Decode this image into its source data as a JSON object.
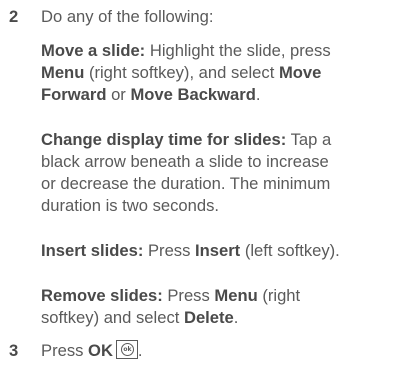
{
  "step2": {
    "number": "2",
    "intro": "Do any of the following:",
    "items": [
      {
        "lines": [
          [
            {
              "t": "Move a slide:",
              "b": true
            },
            {
              "t": " Highlight the slide, press"
            }
          ],
          [
            {
              "t": "Menu",
              "b": true
            },
            {
              "t": " (right softkey), and select "
            },
            {
              "t": "Move",
              "b": true
            }
          ],
          [
            {
              "t": "Forward",
              "b": true
            },
            {
              "t": " or "
            },
            {
              "t": "Move Backward",
              "b": true
            },
            {
              "t": "."
            }
          ]
        ]
      },
      {
        "lines": [
          [
            {
              "t": "Change display time for slides:",
              "b": true
            },
            {
              "t": " Tap a"
            }
          ],
          [
            {
              "t": "black arrow beneath a slide to increase"
            }
          ],
          [
            {
              "t": "or decrease the duration. The minimum"
            }
          ],
          [
            {
              "t": "duration is two seconds."
            }
          ]
        ]
      },
      {
        "lines": [
          [
            {
              "t": "Insert slides:",
              "b": true
            },
            {
              "t": " Press "
            },
            {
              "t": "Insert",
              "b": true
            },
            {
              "t": " (left softkey)."
            }
          ]
        ]
      },
      {
        "lines": [
          [
            {
              "t": "Remove slides:",
              "b": true
            },
            {
              "t": " Press "
            },
            {
              "t": "Menu",
              "b": true
            },
            {
              "t": " (right"
            }
          ],
          [
            {
              "t": "softkey) and select "
            },
            {
              "t": "Delete",
              "b": true
            },
            {
              "t": "."
            }
          ]
        ]
      }
    ]
  },
  "step3": {
    "number": "3",
    "text_prefix": "Press ",
    "ok_label": "OK",
    "icon_name": "ok-button-icon",
    "icon_text": "ok"
  }
}
